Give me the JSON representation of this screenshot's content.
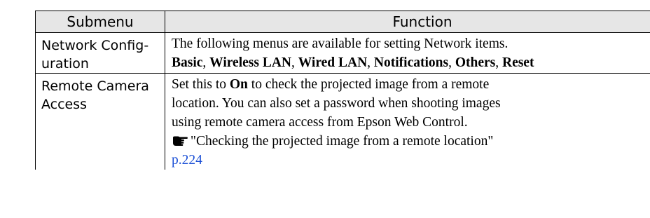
{
  "table": {
    "headers": {
      "submenu": "Submenu",
      "function": "Function"
    },
    "rows": [
      {
        "submenu": "Network Config-\nuration",
        "intro": "The following menus are available for setting Network items.",
        "items": [
          "Basic",
          "Wireless LAN",
          "Wired LAN",
          "Notifications",
          "Others",
          "Reset"
        ],
        "separator": ", "
      },
      {
        "submenu": "Remote Camera\nAccess",
        "line1_pre": "Set this to ",
        "line1_bold": "On",
        "line1_post": " to check the projected image from a remote",
        "line2": "location. You can also set a password when shooting images",
        "line3": "using remote camera access from Epson Web Control.",
        "ref_icon": "pointing-hand-icon",
        "ref_text": "\"Checking the projected image from a remote location\"",
        "ref_page": "p.224"
      }
    ]
  },
  "colors": {
    "header_bg": "#e6e6e6",
    "link": "#1a4fd6",
    "border": "#000000"
  }
}
